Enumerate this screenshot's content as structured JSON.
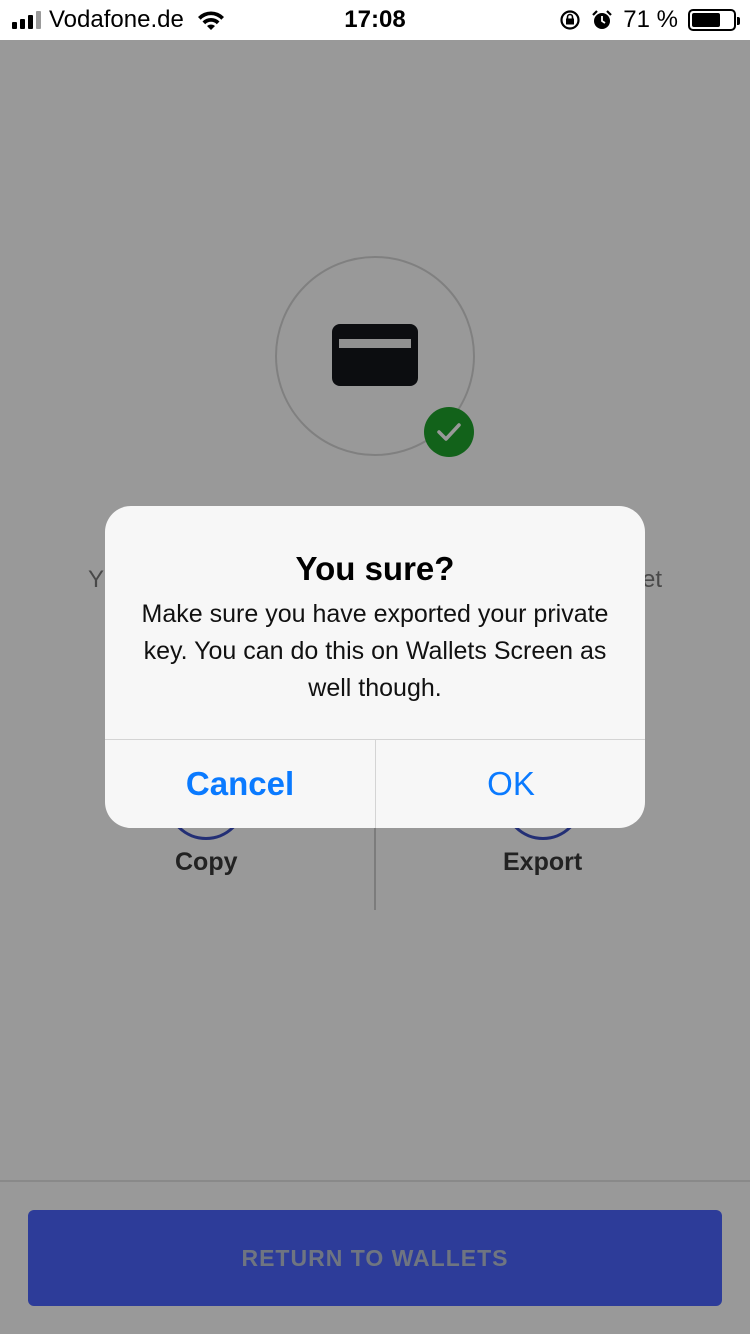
{
  "status_bar": {
    "carrier": "Vodafone.de",
    "time": "17:08",
    "battery_percent": "71 %",
    "battery_level": 0.71
  },
  "screen": {
    "message_fragment_left": "Y",
    "message_fragment_right": "et",
    "actions": [
      {
        "label": "Copy"
      },
      {
        "label": "Export"
      }
    ],
    "return_button": "RETURN TO WALLETS"
  },
  "alert": {
    "title": "You sure?",
    "message": "Make sure you have exported your private key. You can do this on Wallets Screen as well though.",
    "cancel_label": "Cancel",
    "ok_label": "OK"
  },
  "colors": {
    "accent_blue": "#0a7aff",
    "button_primary": "#4b64ff",
    "success_green": "#1fa32c"
  }
}
